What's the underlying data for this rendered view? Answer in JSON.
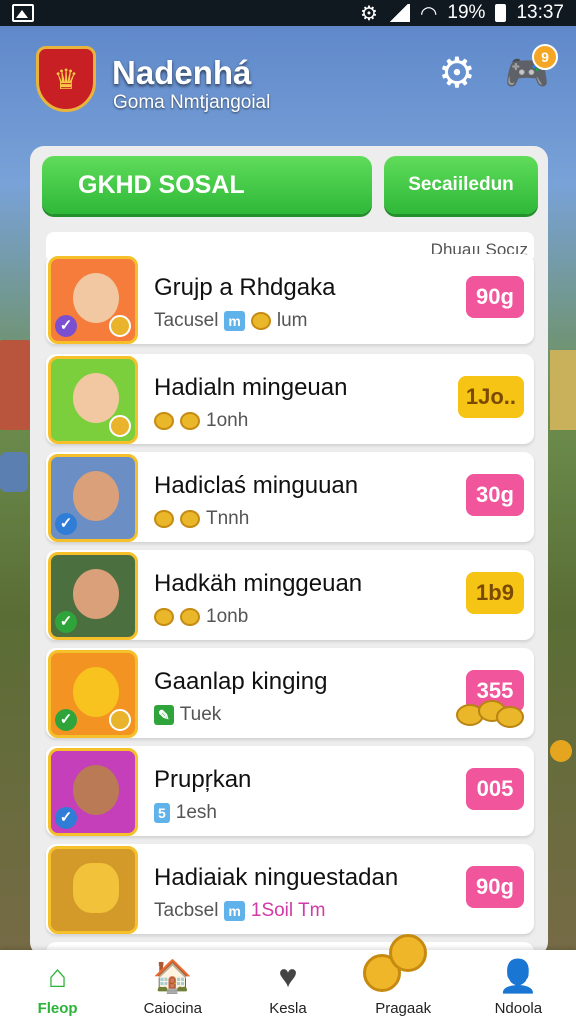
{
  "status_bar": {
    "battery": "19%",
    "time": "13:37",
    "settings_icon": "gear-icon",
    "signal_icon": "signal-icon",
    "wifi_icon": "wifi-icon"
  },
  "header": {
    "title": "Nadenhá",
    "subtitle": "Goma Nmtjangoial",
    "settings_icon": "settings-gear-icon",
    "game_icon": "gamepad-icon",
    "notification_count": "9"
  },
  "tabs": {
    "main_label": "GKHD SOSAL",
    "scheduled_label": "Secaiiledun"
  },
  "list": {
    "header_label": "Dhuaıı Socız",
    "items": [
      {
        "title": "Grujp a Rhdgaka",
        "sub_pre": "Tacusel",
        "sub_badge": "m",
        "sub_post": "lum",
        "reward": "90g",
        "reward_color": "#f1559b",
        "thumb_color": "#f57c3a"
      },
      {
        "title": "Hadialn mingeuan",
        "sub_pre": "",
        "sub_badge": "",
        "sub_post": "1onh",
        "reward": "1Jo..",
        "reward_color": "#f6c415",
        "thumb_color": "#7bcf3c"
      },
      {
        "title": "Hadiclaś minguuan",
        "sub_pre": "",
        "sub_badge": "",
        "sub_post": "Tnnh",
        "reward": "30g",
        "reward_color": "#f1559b",
        "thumb_color": "#6b8fc4"
      },
      {
        "title": "Hadkäh minggeuan",
        "sub_pre": "",
        "sub_badge": "",
        "sub_post": "1onb",
        "reward": "1b9",
        "reward_color": "#f6c415",
        "thumb_color": "#4b6f3f"
      },
      {
        "title": "Gaanlap kinging",
        "sub_pre": "",
        "sub_badge": "",
        "sub_post": "Tuek",
        "reward": "355",
        "reward_color": "#f1559b",
        "thumb_color": "#f39422"
      },
      {
        "title": "Prupŗkan",
        "sub_pre": "",
        "sub_badge": "5",
        "sub_post": "1esh",
        "reward": "005",
        "reward_color": "#f1559b",
        "thumb_color": "#c43fb9"
      },
      {
        "title": "Hadiaiak ninguestadan",
        "sub_pre": "Tacbsel",
        "sub_badge": "m",
        "sub_post": "1Soil Tm",
        "reward": "90g",
        "reward_color": "#f1559b",
        "thumb_color": "#d39a2a"
      }
    ]
  },
  "bottom_nav": {
    "items": [
      {
        "label": "Fleop",
        "icon": "home-icon",
        "active": true
      },
      {
        "label": "Caiocina",
        "icon": "shop-icon",
        "active": false
      },
      {
        "label": "Kesla",
        "icon": "heart-icon",
        "active": false
      },
      {
        "label": "Pragaak",
        "icon": "coins-icon",
        "active": false
      },
      {
        "label": "Ndoola",
        "icon": "profile-icon",
        "active": false
      }
    ]
  }
}
